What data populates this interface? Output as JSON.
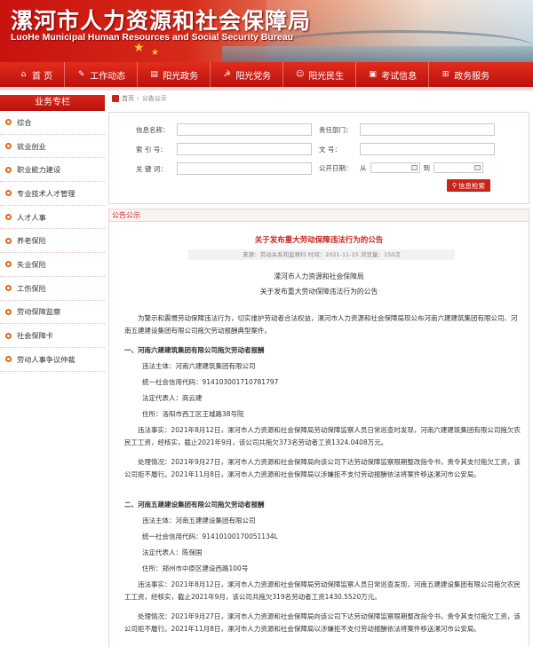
{
  "site": {
    "title_cn": "漯河市人力资源和社会保障局",
    "title_en": "LuoHe Municipal Human Resources and Social Security Bureau"
  },
  "nav": [
    {
      "label": "首 页",
      "icon": "home-icon"
    },
    {
      "label": "工作动态",
      "icon": "chat-icon"
    },
    {
      "label": "阳光政务",
      "icon": "document-icon"
    },
    {
      "label": "阳光党务",
      "icon": "party-emblem-icon"
    },
    {
      "label": "阳光民生",
      "icon": "people-icon"
    },
    {
      "label": "考试信息",
      "icon": "info-icon"
    },
    {
      "label": "政务服务",
      "icon": "grid-icon"
    }
  ],
  "sidebar": {
    "header": "业务专栏",
    "items": [
      "综合",
      "就业创业",
      "职业能力建设",
      "专业技术人才管理",
      "人才人事",
      "养老保险",
      "失业保险",
      "工伤保险",
      "劳动保障监察",
      "社会保障卡",
      "劳动人事争议仲裁"
    ]
  },
  "breadcrumb": [
    "首页",
    "公告公示"
  ],
  "search": {
    "labels": {
      "info_name": "信息名称：",
      "responsible_dept": "责任部门：",
      "index_no": "索 引 号：",
      "doc_no": "文    号：",
      "keywords": "关 键 词：",
      "publish_date": "公开日期：",
      "from": "从",
      "to": "到"
    },
    "button": "信息检索"
  },
  "notice": {
    "section_title": "公告公示",
    "title": "关于发布重大劳动保障违法行为的公告",
    "meta": "来源：劳动关系和监察科   时间：2021-11-15   浏览量：150次",
    "issuer": "漯河市人力资源和社会保障局",
    "subtitle": "关于发布重大劳动保障违法行为的公告",
    "intro": "为警示和震慑劳动保障违法行为，切实维护劳动者合法权益，漯河市人力资源和社会保障局现公布河南六建建筑集团有限公司、河南五建建设集团有限公司拖欠劳动报酬典型案件。",
    "section1": {
      "heading": "一、河南六建建筑集团有限公司拖欠劳动者报酬",
      "entity": "违法主体：河南六建建筑集团有限公司",
      "credit_code": "统一社会信用代码：914103001710781797",
      "legal_rep": "法定代表人：高云建",
      "address": "住所：洛阳市西工区王城路38号院",
      "facts": "违法事实：2021年8月12日，漯河市人力资源和社会保障局劳动保障监察人员日常巡查时发现，河南六建建筑集团有限公司拖欠农民工工资，经核实，截止2021年9月，该公司共拖欠373名劳动者工资1324.0408万元。",
      "handling": "处理情况：2021年9月27日，漯河市人力资源和社会保障局向该公司下达劳动保障监察限期整改指令书，责令其支付拖欠工资，该公司拒不履行。2021年11月8日，漯河市人力资源和社会保障局以涉嫌拒不支付劳动报酬依法将案件移送漯河市公安局。"
    },
    "section2": {
      "heading": "二、河南五建建设集团有限公司拖欠劳动者报酬",
      "entity": "违法主体：河南五建建设集团有限公司",
      "credit_code": "统一社会信用代码：91410100170051134L",
      "legal_rep": "法定代表人：陈保国",
      "address": "住所：郑州市中原区建设西路100号",
      "facts": "违法事实：2021年8月12日，漯河市人力资源和社会保障局劳动保障监察人员日常巡查发现，河南五建建设集团有限公司拖欠农民工工资，经核实，截止2021年9月，该公司共拖欠319名劳动者工资1430.5520万元。",
      "handling": "处理情况：2021年9月27日，漯河市人力资源和社会保障局向该公司下达劳动保障监察限期整改指令书，责令其支付拖欠工资，该公司拒不履行。2021年11月8日，漯河市人力资源和社会保障局以涉嫌拒不支付劳动报酬依法将案件移送漯河市公安局。"
    }
  },
  "colors": {
    "brand_red": "#c9231a",
    "bullet_orange": "#e0661c"
  }
}
